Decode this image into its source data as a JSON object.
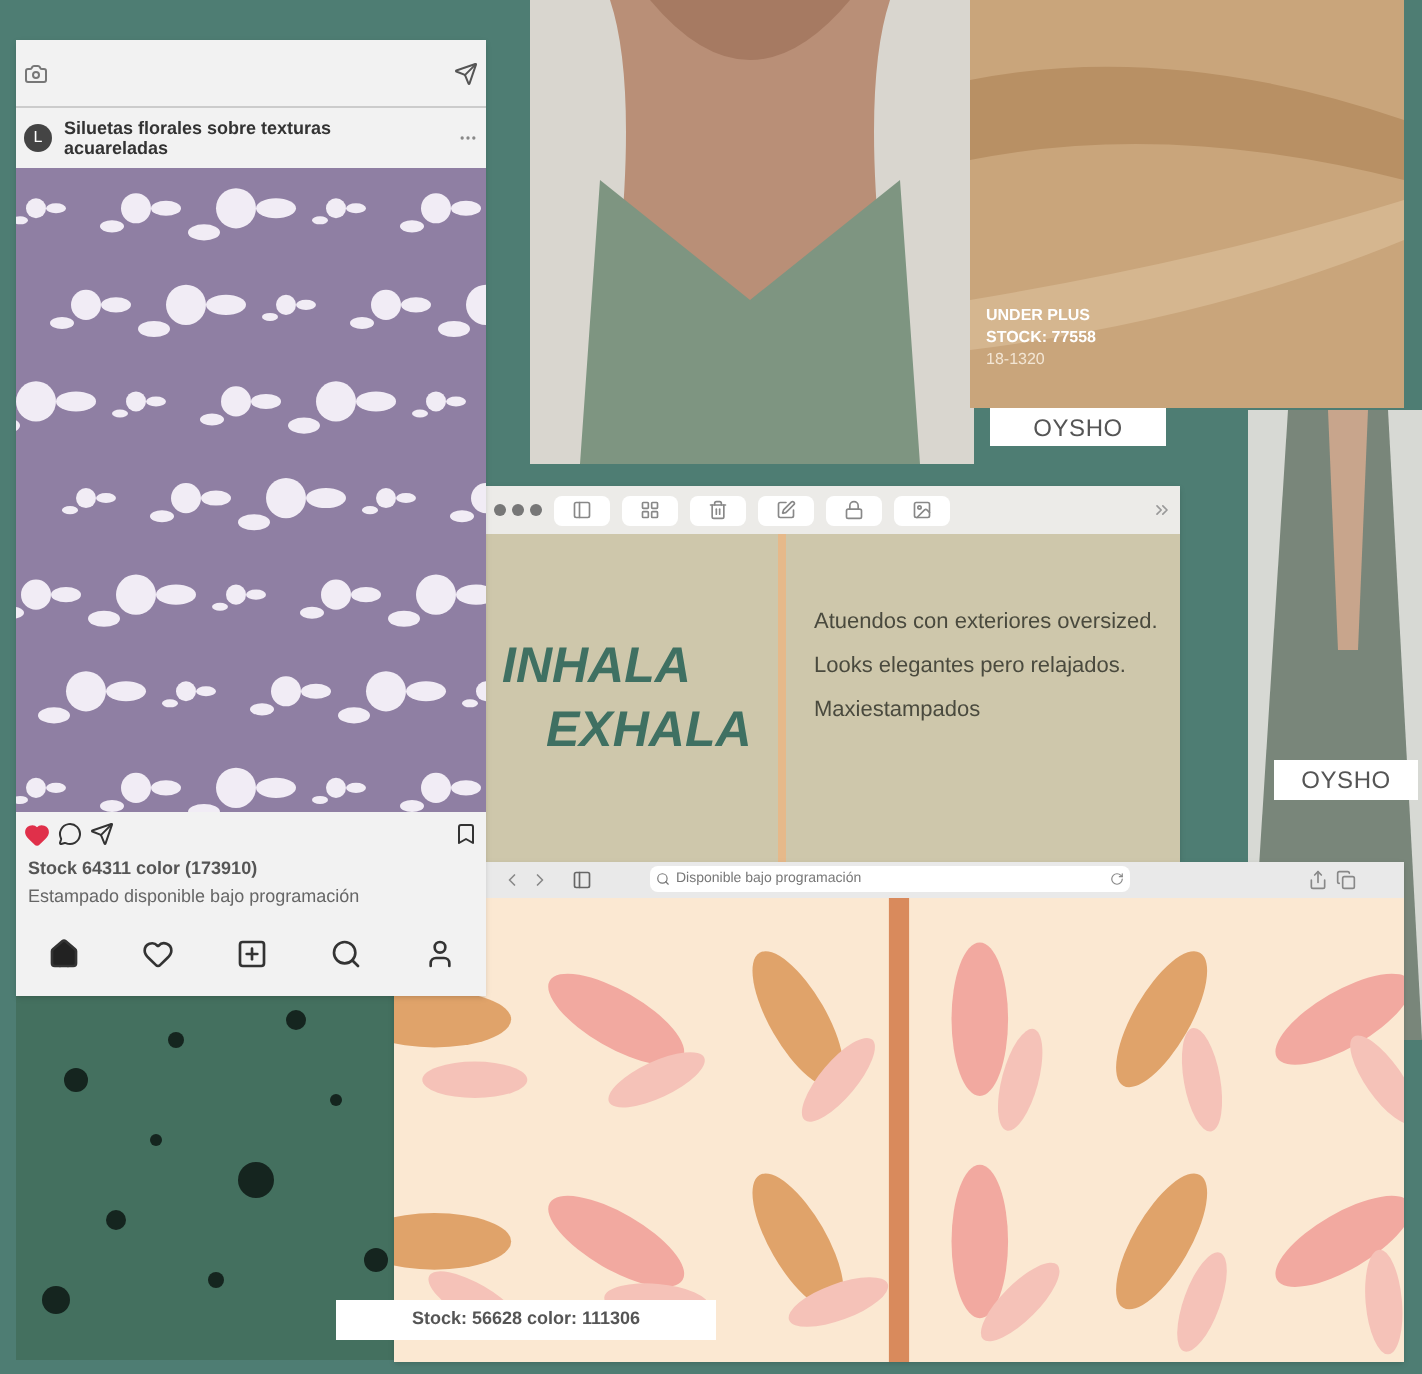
{
  "instagram_post": {
    "title": "Siluetas florales sobre texturas acuareladas",
    "avatar_letter": "L",
    "liked": true,
    "caption_title": "Stock 64311 color (173910)",
    "caption": "Estampado disponible bajo programación",
    "nav": [
      {
        "kind": "home",
        "selected": true
      },
      {
        "kind": "heart",
        "selected": false
      },
      {
        "kind": "add",
        "selected": false
      },
      {
        "kind": "search",
        "selected": false
      },
      {
        "kind": "profile",
        "selected": false
      }
    ]
  },
  "fabric_label": {
    "lines": [
      "UNDER PLUS",
      "STOCK: 77558",
      "18-1320"
    ]
  },
  "brand_tags": [
    "OYSHO",
    "OYSHO"
  ],
  "notes_window": {
    "heading_lines": [
      "INHALA",
      "EXHALA"
    ],
    "notes": [
      "Atuendos con exteriores oversized.",
      "Looks elegantes pero relajados.",
      "Maxiestampados"
    ]
  },
  "browser_window": {
    "address": "Disponible bajo programación"
  },
  "stock_tag": "Stock: 56628 color: 111306"
}
